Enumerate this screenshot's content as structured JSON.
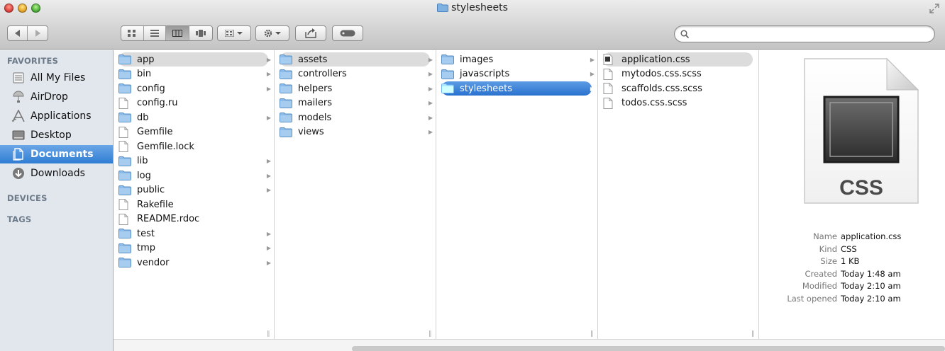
{
  "window": {
    "title": "stylesheets"
  },
  "toolbar": {
    "view_modes": [
      "icon-view",
      "list-view",
      "column-view",
      "cover-flow-view"
    ],
    "active_view": "column-view",
    "search_placeholder": ""
  },
  "sidebar": {
    "sections": {
      "favorites": "FAVORITES",
      "devices": "DEVICES",
      "tags": "TAGS"
    },
    "items": [
      {
        "label": "All My Files",
        "icon": "all-my-files-icon"
      },
      {
        "label": "AirDrop",
        "icon": "airdrop-icon"
      },
      {
        "label": "Applications",
        "icon": "applications-icon"
      },
      {
        "label": "Desktop",
        "icon": "desktop-icon"
      },
      {
        "label": "Documents",
        "icon": "documents-icon",
        "selected": true
      },
      {
        "label": "Downloads",
        "icon": "downloads-icon"
      }
    ]
  },
  "columns": [
    {
      "entries": [
        {
          "name": "app",
          "type": "folder",
          "arrow": true,
          "state": "highlighted"
        },
        {
          "name": "bin",
          "type": "folder",
          "arrow": true
        },
        {
          "name": "config",
          "type": "folder",
          "arrow": true
        },
        {
          "name": "config.ru",
          "type": "file"
        },
        {
          "name": "db",
          "type": "folder",
          "arrow": true
        },
        {
          "name": "Gemfile",
          "type": "file"
        },
        {
          "name": "Gemfile.lock",
          "type": "file"
        },
        {
          "name": "lib",
          "type": "folder",
          "arrow": true
        },
        {
          "name": "log",
          "type": "folder",
          "arrow": true
        },
        {
          "name": "public",
          "type": "folder",
          "arrow": true
        },
        {
          "name": "Rakefile",
          "type": "file"
        },
        {
          "name": "README.rdoc",
          "type": "file"
        },
        {
          "name": "test",
          "type": "folder",
          "arrow": true
        },
        {
          "name": "tmp",
          "type": "folder",
          "arrow": true
        },
        {
          "name": "vendor",
          "type": "folder",
          "arrow": true
        }
      ]
    },
    {
      "entries": [
        {
          "name": "assets",
          "type": "folder",
          "arrow": true,
          "state": "highlighted"
        },
        {
          "name": "controllers",
          "type": "folder",
          "arrow": true
        },
        {
          "name": "helpers",
          "type": "folder",
          "arrow": true
        },
        {
          "name": "mailers",
          "type": "folder",
          "arrow": true
        },
        {
          "name": "models",
          "type": "folder",
          "arrow": true
        },
        {
          "name": "views",
          "type": "folder",
          "arrow": true
        }
      ]
    },
    {
      "entries": [
        {
          "name": "images",
          "type": "folder",
          "arrow": true
        },
        {
          "name": "javascripts",
          "type": "folder",
          "arrow": true
        },
        {
          "name": "stylesheets",
          "type": "folder",
          "arrow": true,
          "state": "selected"
        }
      ]
    },
    {
      "entries": [
        {
          "name": "application.css",
          "type": "css-file",
          "state": "highlighted"
        },
        {
          "name": "mytodos.css.scss",
          "type": "file"
        },
        {
          "name": "scaffolds.css.scss",
          "type": "file"
        },
        {
          "name": "todos.css.scss",
          "type": "file"
        }
      ]
    }
  ],
  "preview": {
    "icon_label": "CSS",
    "info": [
      {
        "key": "Name",
        "value": "application.css"
      },
      {
        "key": "Kind",
        "value": "CSS"
      },
      {
        "key": "Size",
        "value": "1 KB"
      },
      {
        "key": "Created",
        "value": "Today 1:48 am"
      },
      {
        "key": "Modified",
        "value": "Today 2:10 am"
      },
      {
        "key": "Last opened",
        "value": "Today 2:10 am"
      }
    ]
  }
}
